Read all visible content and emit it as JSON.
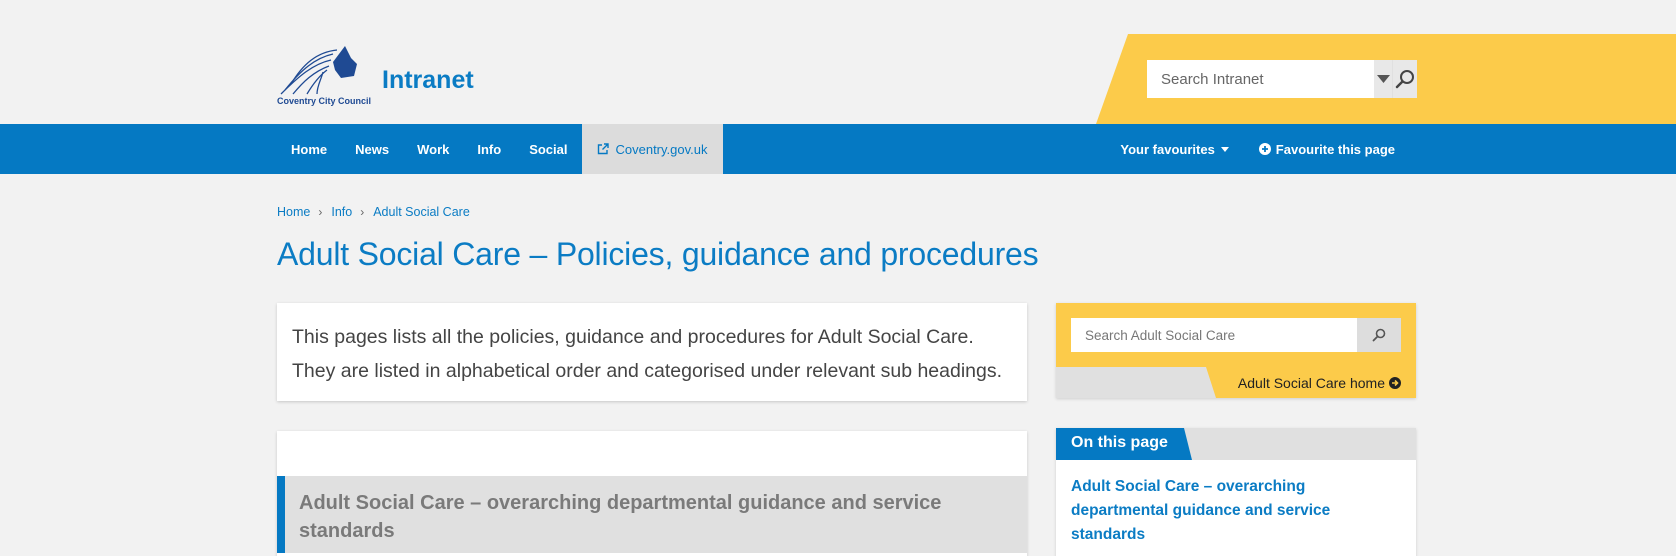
{
  "header": {
    "logo_text": "Coventry City Council",
    "site_title": "Intranet",
    "search_placeholder": "Search Intranet"
  },
  "nav": {
    "items": [
      {
        "label": "Home"
      },
      {
        "label": "News"
      },
      {
        "label": "Work"
      },
      {
        "label": "Info"
      },
      {
        "label": "Social"
      }
    ],
    "external_label": "Coventry.gov.uk",
    "favourites_label": "Your favourites",
    "favourite_page_label": "Favourite this page"
  },
  "breadcrumb": [
    "Home",
    "Info",
    "Adult Social Care"
  ],
  "page_title": "Adult Social Care – Policies, guidance and procedures",
  "intro": "This pages lists all the policies, guidance and procedures for Adult Social Care. They are listed in alphabetical order and categorised under relevant sub headings.",
  "content": {
    "section_heading": "Adult Social Care – overarching departmental guidance and service standards"
  },
  "sidebar": {
    "search_placeholder": "Search Adult Social Care",
    "home_link": "Adult Social Care home",
    "on_this_page_label": "On this page",
    "on_this_page_links": [
      "Adult Social Care – overarching departmental guidance and service standards"
    ]
  },
  "colors": {
    "brand_blue": "#0579c3",
    "accent_yellow": "#fccb4a",
    "background": "#f2f2f2"
  }
}
